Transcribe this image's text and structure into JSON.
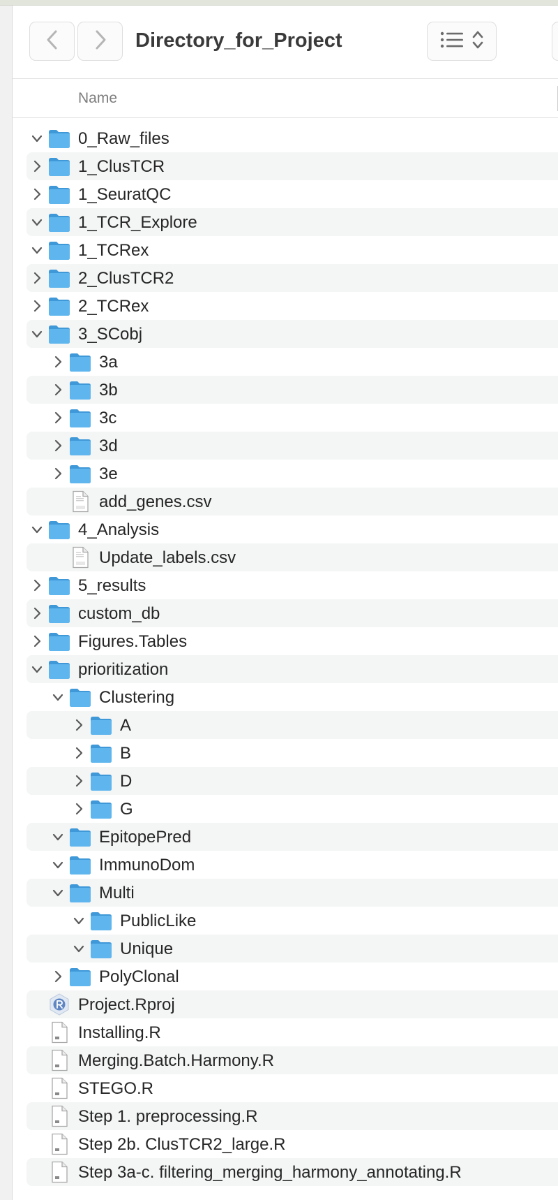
{
  "window": {
    "title": "Directory_for_Project",
    "back_icon": "chevron-left-icon",
    "forward_icon": "chevron-right-icon",
    "view_icon": "list-view-icon",
    "view_menu_icon": "up-down-chevron-icon"
  },
  "columns": {
    "name": "Name"
  },
  "colors": {
    "folder": "#5fb6ee",
    "folder_dark": "#3f98d8",
    "stripe": "#f4f5f5",
    "text": "#262626"
  },
  "rows": [
    {
      "label": "0_Raw_files",
      "depth": 0,
      "type": "folder",
      "state": "expanded"
    },
    {
      "label": "1_ClusTCR",
      "depth": 0,
      "type": "folder",
      "state": "collapsed"
    },
    {
      "label": "1_SeuratQC",
      "depth": 0,
      "type": "folder",
      "state": "collapsed"
    },
    {
      "label": "1_TCR_Explore",
      "depth": 0,
      "type": "folder",
      "state": "expanded"
    },
    {
      "label": "1_TCRex",
      "depth": 0,
      "type": "folder",
      "state": "expanded"
    },
    {
      "label": "2_ClusTCR2",
      "depth": 0,
      "type": "folder",
      "state": "collapsed"
    },
    {
      "label": "2_TCRex",
      "depth": 0,
      "type": "folder",
      "state": "collapsed"
    },
    {
      "label": "3_SCobj",
      "depth": 0,
      "type": "folder",
      "state": "expanded"
    },
    {
      "label": "3a",
      "depth": 1,
      "type": "folder",
      "state": "collapsed"
    },
    {
      "label": "3b",
      "depth": 1,
      "type": "folder",
      "state": "collapsed"
    },
    {
      "label": "3c",
      "depth": 1,
      "type": "folder",
      "state": "collapsed"
    },
    {
      "label": "3d",
      "depth": 1,
      "type": "folder",
      "state": "collapsed"
    },
    {
      "label": "3e",
      "depth": 1,
      "type": "folder",
      "state": "collapsed"
    },
    {
      "label": "add_genes.csv",
      "depth": 1,
      "type": "csv",
      "state": "none"
    },
    {
      "label": "4_Analysis",
      "depth": 0,
      "type": "folder",
      "state": "expanded"
    },
    {
      "label": "Update_labels.csv",
      "depth": 1,
      "type": "csv",
      "state": "none"
    },
    {
      "label": "5_results",
      "depth": 0,
      "type": "folder",
      "state": "collapsed"
    },
    {
      "label": "custom_db",
      "depth": 0,
      "type": "folder",
      "state": "collapsed"
    },
    {
      "label": "Figures.Tables",
      "depth": 0,
      "type": "folder",
      "state": "collapsed"
    },
    {
      "label": "prioritization",
      "depth": 0,
      "type": "folder",
      "state": "expanded"
    },
    {
      "label": "Clustering",
      "depth": 1,
      "type": "folder",
      "state": "expanded"
    },
    {
      "label": "A",
      "depth": 2,
      "type": "folder",
      "state": "collapsed"
    },
    {
      "label": "B",
      "depth": 2,
      "type": "folder",
      "state": "collapsed"
    },
    {
      "label": "D",
      "depth": 2,
      "type": "folder",
      "state": "collapsed"
    },
    {
      "label": "G",
      "depth": 2,
      "type": "folder",
      "state": "collapsed"
    },
    {
      "label": "EpitopePred",
      "depth": 1,
      "type": "folder",
      "state": "expanded"
    },
    {
      "label": "ImmunoDom",
      "depth": 1,
      "type": "folder",
      "state": "expanded"
    },
    {
      "label": "Multi",
      "depth": 1,
      "type": "folder",
      "state": "expanded"
    },
    {
      "label": "PublicLike",
      "depth": 2,
      "type": "folder",
      "state": "expanded"
    },
    {
      "label": "Unique",
      "depth": 2,
      "type": "folder",
      "state": "expanded"
    },
    {
      "label": "PolyClonal",
      "depth": 1,
      "type": "folder",
      "state": "collapsed"
    },
    {
      "label": "Project.Rproj",
      "depth": 0,
      "type": "rproj",
      "state": "none"
    },
    {
      "label": "Installing.R",
      "depth": 0,
      "type": "r",
      "state": "none"
    },
    {
      "label": "Merging.Batch.Harmony.R",
      "depth": 0,
      "type": "r",
      "state": "none"
    },
    {
      "label": "STEGO.R",
      "depth": 0,
      "type": "r",
      "state": "none"
    },
    {
      "label": "Step 1. preprocessing.R",
      "depth": 0,
      "type": "r",
      "state": "none"
    },
    {
      "label": "Step 2b. ClusTCR2_large.R",
      "depth": 0,
      "type": "r",
      "state": "none"
    },
    {
      "label": "Step 3a-c. filtering_merging_harmony_annotating.R",
      "depth": 0,
      "type": "r",
      "state": "none"
    }
  ]
}
